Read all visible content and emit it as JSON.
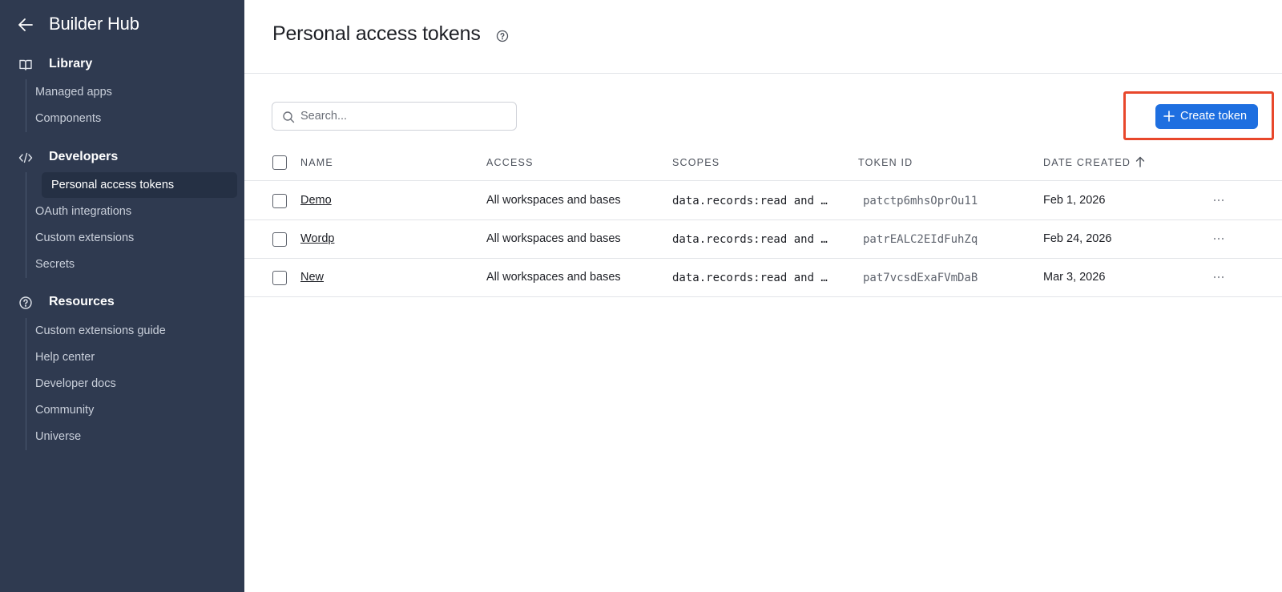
{
  "sidebar": {
    "title": "Builder Hub",
    "sections": [
      {
        "label": "Library",
        "icon": "book-icon",
        "items": [
          {
            "label": "Managed apps"
          },
          {
            "label": "Components"
          }
        ]
      },
      {
        "label": "Developers",
        "icon": "code-icon",
        "items": [
          {
            "label": "Personal access tokens",
            "active": true
          },
          {
            "label": "OAuth integrations"
          },
          {
            "label": "Custom extensions"
          },
          {
            "label": "Secrets"
          }
        ]
      },
      {
        "label": "Resources",
        "icon": "help-circle-icon",
        "items": [
          {
            "label": "Custom extensions guide"
          },
          {
            "label": "Help center"
          },
          {
            "label": "Developer docs"
          },
          {
            "label": "Community"
          },
          {
            "label": "Universe"
          }
        ]
      }
    ]
  },
  "main": {
    "title": "Personal access tokens",
    "search": {
      "placeholder": "Search...",
      "value": ""
    },
    "create_button": "Create token",
    "columns": [
      "NAME",
      "ACCESS",
      "SCOPES",
      "TOKEN ID",
      "DATE CREATED"
    ],
    "rows": [
      {
        "name": "Demo",
        "access": "All workspaces and bases",
        "scopes": "data.records:read and …",
        "token_id": "patctp6mhsOprOu11",
        "date": "Feb 1, 2026"
      },
      {
        "name": "Wordp",
        "access": "All workspaces and bases",
        "scopes": "data.records:read and …",
        "token_id": "patrEALC2EIdFuhZq",
        "date": "Feb 24, 2026"
      },
      {
        "name": "New",
        "access": "All workspaces and bases",
        "scopes": "data.records:read and …",
        "token_id": "pat7vcsdExaFVmDaB",
        "date": "Mar 3, 2026"
      }
    ]
  },
  "colors": {
    "sidebar_bg": "#2f3a50",
    "accent": "#1e6fe0",
    "highlight": "#e8472b"
  }
}
